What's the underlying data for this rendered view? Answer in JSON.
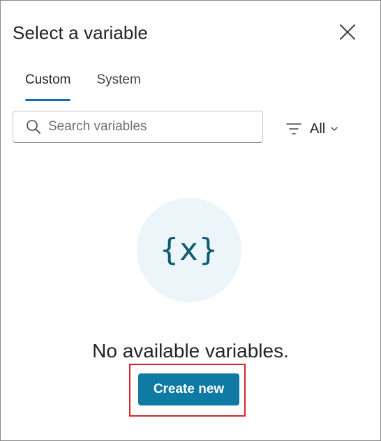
{
  "dialog": {
    "title": "Select a variable",
    "close_icon": "close-icon"
  },
  "tabs": [
    {
      "label": "Custom",
      "active": true
    },
    {
      "label": "System",
      "active": false
    }
  ],
  "search": {
    "placeholder": "Search variables",
    "value": "",
    "icon": "search-icon"
  },
  "filter": {
    "icon": "filter-icon",
    "label": "All",
    "chevron": "chevron-down-icon"
  },
  "empty_state": {
    "icon": "variable-icon",
    "glyph": "{x}",
    "message": "No available variables."
  },
  "actions": {
    "create_label": "Create new"
  },
  "colors": {
    "accent": "#0f6cbd",
    "button": "#0f7aa3",
    "icon_circle": "#ebf5fa",
    "icon_glyph": "#0d5c72",
    "highlight": "#d9252f"
  }
}
